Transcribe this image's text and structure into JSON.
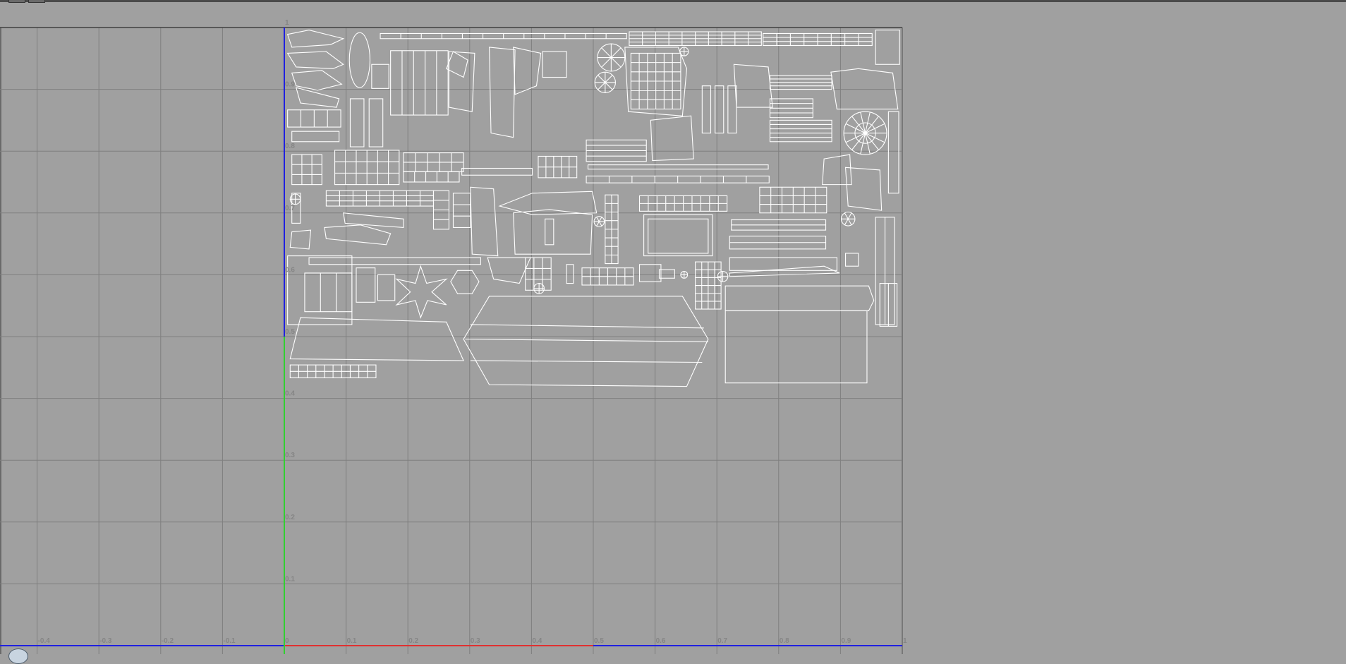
{
  "uv_editor": {
    "u_ticks": [
      "-0.4",
      "-0.3",
      "-0.2",
      "-0.1",
      "0",
      "0.1",
      "0.2",
      "0.3",
      "0.4",
      "0.5",
      "0.6",
      "0.7",
      "0.8",
      "0.9",
      "1"
    ],
    "v_ticks": [
      "1",
      "0.9",
      "0.8",
      "0.7",
      "0.6",
      "0.5",
      "0.4",
      "0.3",
      "0.2",
      "0.1"
    ],
    "colors": {
      "background": "#a0a0a0",
      "grid": "#7f7f7f",
      "u_axis": "#e03030",
      "v_axis": "#30d030",
      "axis_other": "#2020e0",
      "wireframe": "#ffffff"
    }
  }
}
